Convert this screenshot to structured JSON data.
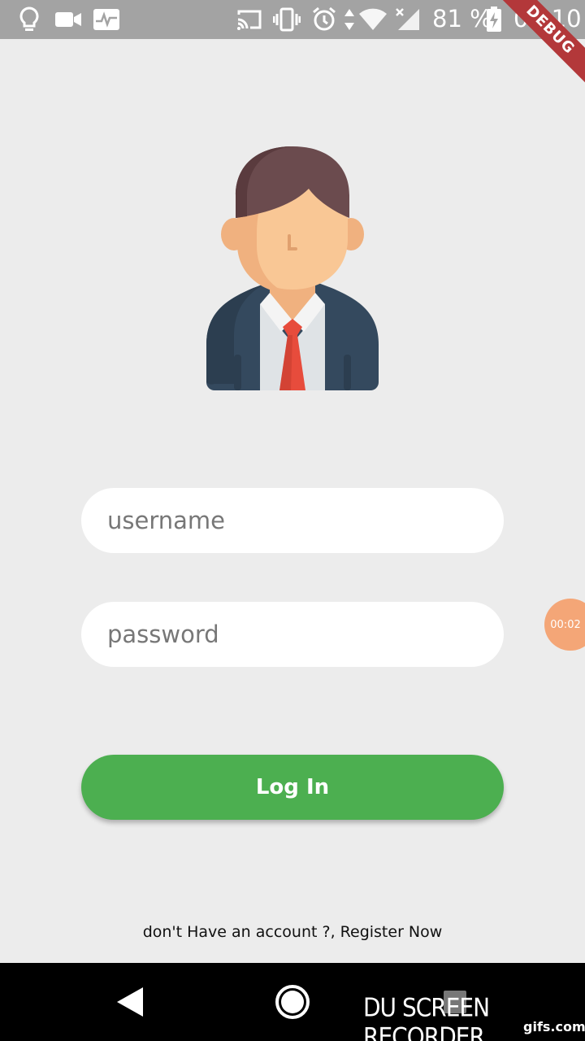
{
  "status_bar": {
    "battery_percent": "81 %",
    "time": "04:10",
    "icons": [
      "lightbulb-icon",
      "video-camera-icon",
      "activity-icon",
      "cast-icon",
      "vibrate-icon",
      "alarm-icon",
      "data-arrows-icon",
      "wifi-icon",
      "signal-icon",
      "battery-charging-icon"
    ]
  },
  "debug_banner": "DEBUG",
  "avatar": {
    "icon": "businessman-avatar-icon"
  },
  "form": {
    "username_placeholder": "username",
    "password_placeholder": "password",
    "login_label": "Log In",
    "register_text": "don't Have an account ?, Register Now"
  },
  "recorder": {
    "timer": "00:02",
    "watermark": "DU SCREEN RECORDER",
    "watermark_site": "gifs.com"
  },
  "colors": {
    "login_button": "#4caf50",
    "background": "#ececec",
    "status_bar": "#a3a3a3",
    "debug_banner": "#b3383a"
  }
}
